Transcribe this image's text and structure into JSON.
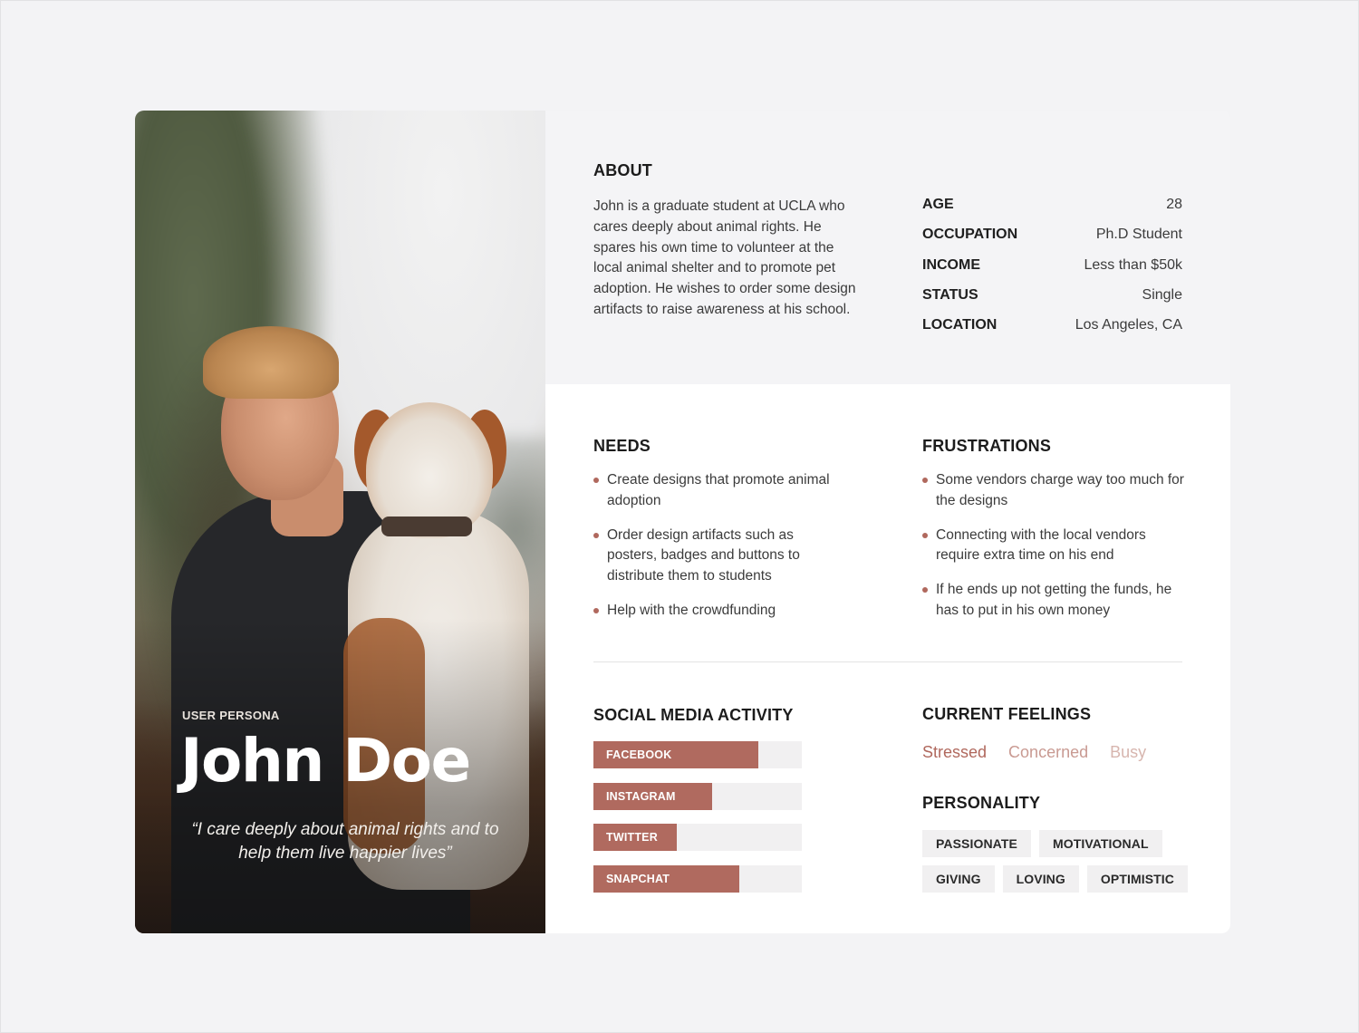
{
  "persona": {
    "eyebrow": "USER PERSONA",
    "name": "John Doe",
    "quote": "“I care deeply about animal rights and to help them live happier lives”",
    "photo_description": "man holding a brown and white dog outdoors"
  },
  "about": {
    "title": "ABOUT",
    "text": "John is a graduate student at UCLA who cares deeply about animal rights. He spares his own time to volunteer at the local animal shelter and to promote pet adoption. He wishes to order some design artifacts to raise awareness at his school.",
    "facts": [
      {
        "label": "AGE",
        "value": "28"
      },
      {
        "label": "OCCUPATION",
        "value": "Ph.D Student"
      },
      {
        "label": "INCOME",
        "value": "Less than $50k"
      },
      {
        "label": "STATUS",
        "value": "Single"
      },
      {
        "label": "LOCATION",
        "value": "Los Angeles, CA"
      }
    ]
  },
  "needs": {
    "title": "NEEDS",
    "items": [
      "Create designs that promote animal adoption",
      "Order design artifacts such as posters, badges and buttons to distribute them to students",
      "Help with the crowdfunding"
    ]
  },
  "frustrations": {
    "title": "FRUSTRATIONS",
    "items": [
      "Some vendors charge way too much for the designs",
      "Connecting with the local vendors require extra time on his end",
      "If he ends up not getting the funds, he has to put in his own money"
    ]
  },
  "social": {
    "title": "SOCIAL MEDIA ACTIVITY",
    "bar_color": "#b06a5f",
    "track_color": "#f1f0f1",
    "items": [
      {
        "label": "FACEBOOK",
        "level": 0.79
      },
      {
        "label": "INSTAGRAM",
        "level": 0.57
      },
      {
        "label": "TWITTER",
        "level": 0.4
      },
      {
        "label": "SNAPCHAT",
        "level": 0.7
      }
    ]
  },
  "feelings": {
    "title": "CURRENT FEELINGS",
    "items": [
      {
        "label": "Stressed",
        "color": "#b0685d"
      },
      {
        "label": "Concerned",
        "color": "#c99a92"
      },
      {
        "label": "Busy",
        "color": "#d7b5ae"
      }
    ]
  },
  "personality": {
    "title": "PERSONALITY",
    "rows": [
      [
        "PASSIONATE",
        "MOTIVATIONAL"
      ],
      [
        "GIVING",
        "LOVING",
        "OPTIMISTIC"
      ]
    ]
  },
  "colors": {
    "accent": "#b06a5f",
    "background": "#f3f3f5",
    "panel_white": "#ffffff"
  }
}
